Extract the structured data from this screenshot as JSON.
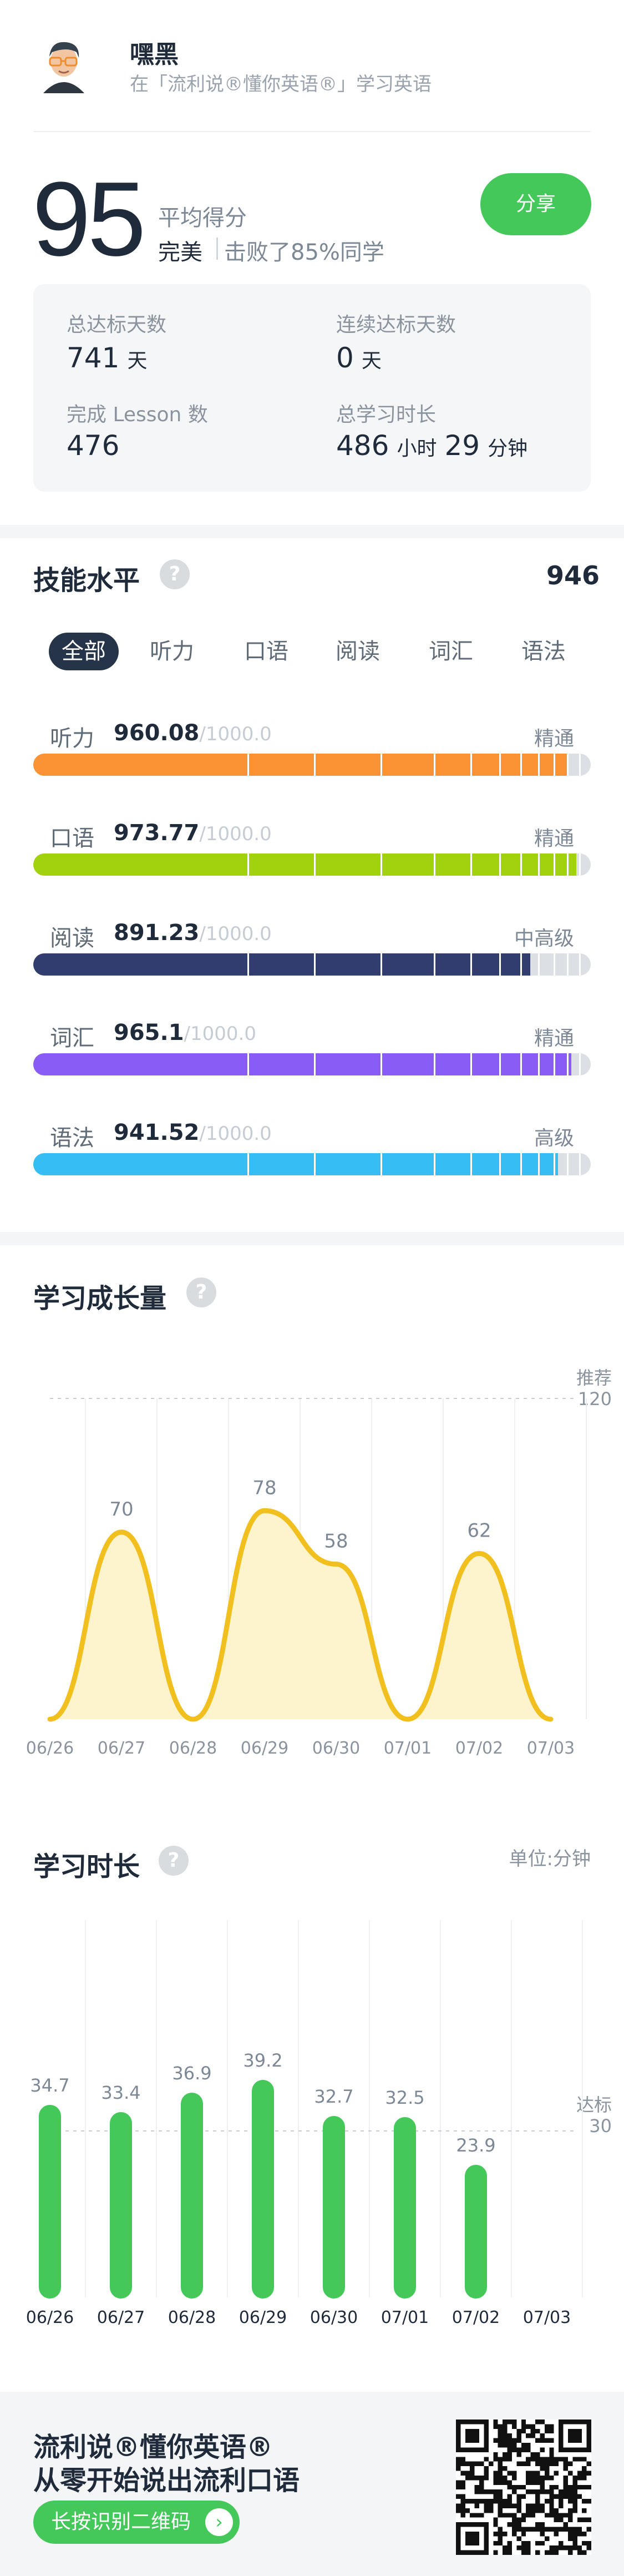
{
  "user": {
    "name": "嘿黑",
    "subtitle": "在「流利说®懂你英语®」学习英语"
  },
  "score": {
    "value": "95",
    "avg_label": "平均得分",
    "grade": "完美",
    "beat": "击败了85%同学",
    "share": "分享"
  },
  "stats": {
    "days_label": "总达标天数",
    "days_value": "741",
    "days_unit": "天",
    "streak_label": "连续达标天数",
    "streak_value": "0",
    "streak_unit": "天",
    "lessons_label": "完成 Lesson 数",
    "lessons_value": "476",
    "time_label": "总学习时长",
    "time_h": "486",
    "time_h_unit": "小时",
    "time_m": "29",
    "time_m_unit": "分钟"
  },
  "skills": {
    "title": "技能水平",
    "help": "?",
    "total": "946",
    "tabs": [
      "全部",
      "听力",
      "口语",
      "阅读",
      "词汇",
      "语法"
    ],
    "items": [
      {
        "name": "听力",
        "value": "960.08",
        "max": "/1000.0",
        "level": "精通",
        "fraction": 0.9601,
        "color": "#fb9334"
      },
      {
        "name": "口语",
        "value": "973.77",
        "max": "/1000.0",
        "level": "精通",
        "fraction": 0.9738,
        "color": "#a1d20d"
      },
      {
        "name": "阅读",
        "value": "891.23",
        "max": "/1000.0",
        "level": "中高级",
        "fraction": 0.8912,
        "color": "#313c6f"
      },
      {
        "name": "词汇",
        "value": "965.1",
        "max": "/1000.0",
        "level": "精通",
        "fraction": 0.9651,
        "color": "#8a5cf6"
      },
      {
        "name": "语法",
        "value": "941.52",
        "max": "/1000.0",
        "level": "高级",
        "fraction": 0.9415,
        "color": "#35bdf4"
      }
    ]
  },
  "growth": {
    "title": "学习成长量",
    "help": "?",
    "ref_label_1": "推荐",
    "ref_label_2": "120"
  },
  "duration": {
    "title": "学习时长",
    "help": "?",
    "unit": "单位:分钟",
    "ref_label_1": "达标",
    "ref_label_2": "30"
  },
  "chart_data": [
    {
      "type": "area",
      "title": "学习成长量",
      "categories": [
        "06/26",
        "06/27",
        "06/28",
        "06/29",
        "06/30",
        "07/01",
        "07/02",
        "07/03"
      ],
      "values": [
        0,
        70,
        0,
        78,
        58,
        0,
        62,
        0
      ],
      "ylim": [
        0,
        120
      ],
      "reference_line": {
        "label": "推荐",
        "value": 120
      },
      "color": "#f1c01f"
    },
    {
      "type": "bar",
      "title": "学习时长",
      "categories": [
        "06/26",
        "06/27",
        "06/28",
        "06/29",
        "06/30",
        "07/01",
        "07/02",
        "07/03"
      ],
      "values": [
        34.7,
        33.4,
        36.9,
        39.2,
        32.7,
        32.5,
        23.9,
        null
      ],
      "reference_line": {
        "label": "达标",
        "value": 30
      },
      "unit": "单位:分钟",
      "color": "#45c85a"
    }
  ],
  "footer": {
    "line1": "流利说®懂你英语®",
    "line2": "从零开始说出流利口语",
    "button": "长按识别二维码",
    "arrow": "›"
  }
}
